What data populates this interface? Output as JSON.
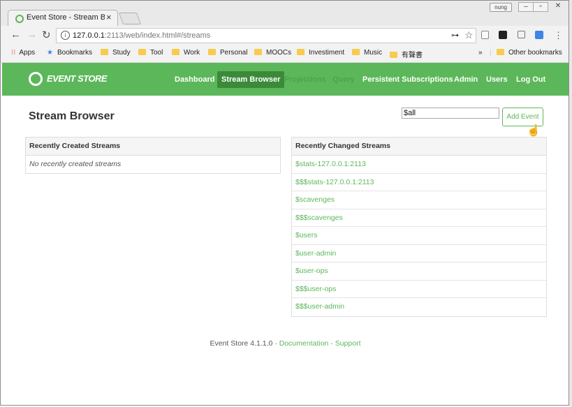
{
  "browser": {
    "tab_title": "Event Store - Stream Bro",
    "user_label": "nung",
    "url_host": "127.0.0.1",
    "url_rest": ":2113/web/index.html#/streams",
    "bookmarks": [
      "Apps",
      "Bookmarks",
      "Study",
      "Tool",
      "Work",
      "Personal",
      "MOOCs",
      "Investiment",
      "Music",
      "有聲書"
    ],
    "overflow": "»",
    "other_bookmarks": "Other bookmarks"
  },
  "app": {
    "logo": "EVENT STORE",
    "nav": [
      {
        "label": "Dashboard",
        "state": "normal"
      },
      {
        "label": "Stream Browser",
        "state": "active"
      },
      {
        "label": "Projections",
        "state": "disabled"
      },
      {
        "label": "Query",
        "state": "disabled"
      },
      {
        "label": "Persistent Subscriptions",
        "state": "normal"
      },
      {
        "label": "Admin",
        "state": "normal"
      },
      {
        "label": "Users",
        "state": "normal"
      },
      {
        "label": "Log Out",
        "state": "normal"
      }
    ],
    "accent": "#5cb75a"
  },
  "page": {
    "title": "Stream Browser",
    "search_value": "$all",
    "add_event_label": "Add Event",
    "recent_created": {
      "header": "Recently Created Streams",
      "empty": "No recently created streams"
    },
    "recent_changed": {
      "header": "Recently Changed Streams",
      "items": [
        "$stats-127.0.0.1:2113",
        "$$$stats-127.0.0.1:2113",
        "$scavenges",
        "$$$scavenges",
        "$users",
        "$user-admin",
        "$user-ops",
        "$$$user-ops",
        "$$$user-admin"
      ]
    },
    "footer": {
      "version": "Event Store 4.1.1.0",
      "sep1": " · ",
      "docs": "Documentation",
      "sep2": " · ",
      "support": "Support"
    }
  }
}
